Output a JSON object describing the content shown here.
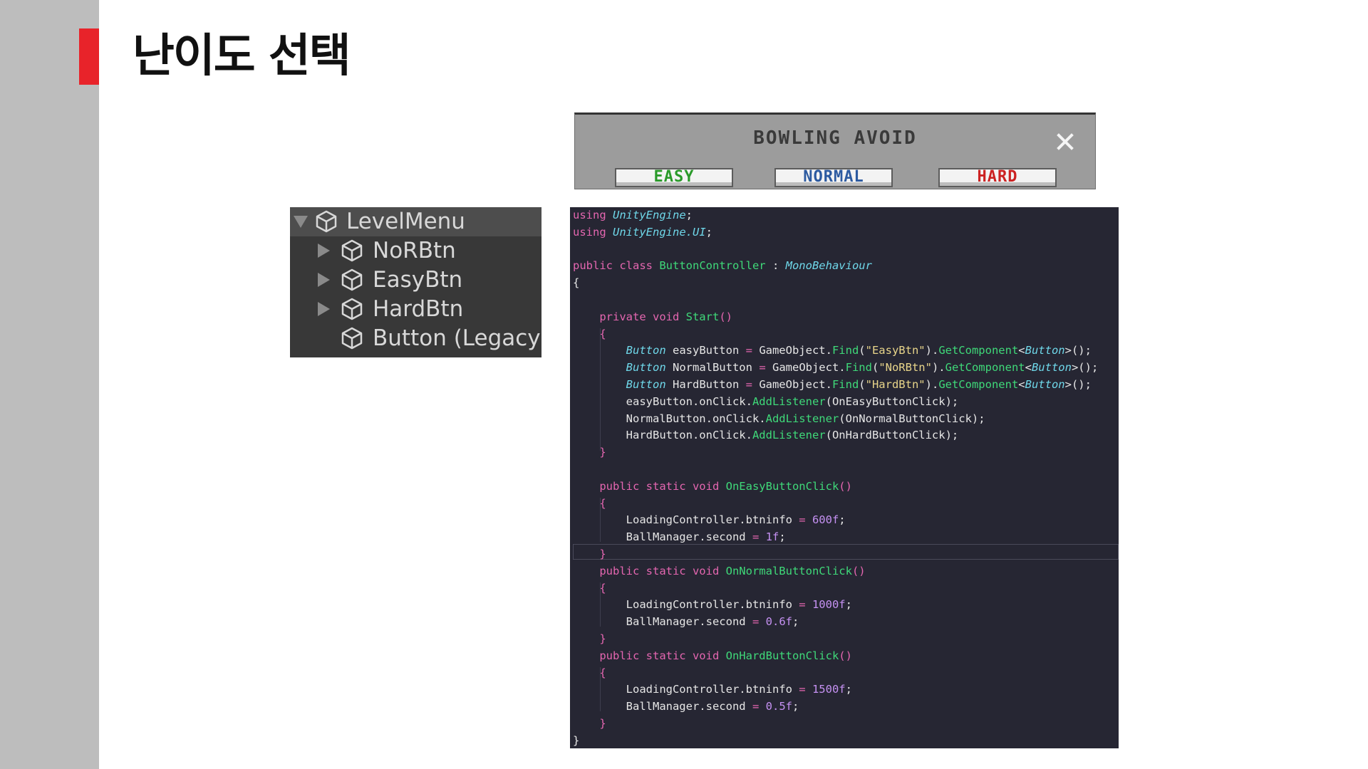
{
  "slide": {
    "title": "난이도 선택",
    "accent_color": "#e8232a"
  },
  "game": {
    "title": "BOWLING AVOID",
    "close_icon": "close-icon",
    "buttons": [
      {
        "label": "EASY",
        "color": "#2a9a2a"
      },
      {
        "label": "NORMAL",
        "color": "#2c5aa0"
      },
      {
        "label": "HARD",
        "color": "#cc2222"
      }
    ]
  },
  "hierarchy": {
    "root": "LevelMenu",
    "children": [
      "NoRBtn",
      "EasyBtn",
      "HardBtn",
      "Button (Legacy)"
    ],
    "icon": "cube-icon"
  },
  "code": {
    "lines": [
      [
        {
          "t": "using ",
          "c": "kw"
        },
        {
          "t": "UnityEngine",
          "c": "ty"
        },
        {
          "t": ";",
          "c": "pl"
        }
      ],
      [
        {
          "t": "using ",
          "c": "kw"
        },
        {
          "t": "UnityEngine.UI",
          "c": "ty"
        },
        {
          "t": ";",
          "c": "pl"
        }
      ],
      [],
      [
        {
          "t": "public class ",
          "c": "kw"
        },
        {
          "t": "ButtonController",
          "c": "me"
        },
        {
          "t": " : ",
          "c": "pl"
        },
        {
          "t": "MonoBehaviour",
          "c": "ty"
        }
      ],
      [
        {
          "t": "{",
          "c": "pl"
        }
      ],
      [],
      [
        {
          "t": "    private void ",
          "c": "kw"
        },
        {
          "t": "Start",
          "c": "me"
        },
        {
          "t": "()",
          "c": "kw"
        }
      ],
      [
        {
          "t": "    {",
          "c": "kw"
        }
      ],
      [
        {
          "t": "        ",
          "c": "pl"
        },
        {
          "t": "Button",
          "c": "ty"
        },
        {
          "t": " easyButton ",
          "c": "pl"
        },
        {
          "t": "=",
          "c": "op"
        },
        {
          "t": " GameObject.",
          "c": "pl"
        },
        {
          "t": "Find",
          "c": "me"
        },
        {
          "t": "(",
          "c": "pl"
        },
        {
          "t": "\"EasyBtn\"",
          "c": "st"
        },
        {
          "t": ").",
          "c": "pl"
        },
        {
          "t": "GetComponent",
          "c": "me"
        },
        {
          "t": "<",
          "c": "pl"
        },
        {
          "t": "Button",
          "c": "ty"
        },
        {
          "t": ">();",
          "c": "pl"
        }
      ],
      [
        {
          "t": "        ",
          "c": "pl"
        },
        {
          "t": "Button",
          "c": "ty"
        },
        {
          "t": " NormalButton ",
          "c": "pl"
        },
        {
          "t": "=",
          "c": "op"
        },
        {
          "t": " GameObject.",
          "c": "pl"
        },
        {
          "t": "Find",
          "c": "me"
        },
        {
          "t": "(",
          "c": "pl"
        },
        {
          "t": "\"NoRBtn\"",
          "c": "st"
        },
        {
          "t": ").",
          "c": "pl"
        },
        {
          "t": "GetComponent",
          "c": "me"
        },
        {
          "t": "<",
          "c": "pl"
        },
        {
          "t": "Button",
          "c": "ty"
        },
        {
          "t": ">();",
          "c": "pl"
        }
      ],
      [
        {
          "t": "        ",
          "c": "pl"
        },
        {
          "t": "Button",
          "c": "ty"
        },
        {
          "t": " HardButton ",
          "c": "pl"
        },
        {
          "t": "=",
          "c": "op"
        },
        {
          "t": " GameObject.",
          "c": "pl"
        },
        {
          "t": "Find",
          "c": "me"
        },
        {
          "t": "(",
          "c": "pl"
        },
        {
          "t": "\"HardBtn\"",
          "c": "st"
        },
        {
          "t": ").",
          "c": "pl"
        },
        {
          "t": "GetComponent",
          "c": "me"
        },
        {
          "t": "<",
          "c": "pl"
        },
        {
          "t": "Button",
          "c": "ty"
        },
        {
          "t": ">();",
          "c": "pl"
        }
      ],
      [
        {
          "t": "        easyButton.onClick.",
          "c": "pl"
        },
        {
          "t": "AddListener",
          "c": "me"
        },
        {
          "t": "(OnEasyButtonClick);",
          "c": "pl"
        }
      ],
      [
        {
          "t": "        NormalButton.onClick.",
          "c": "pl"
        },
        {
          "t": "AddListener",
          "c": "me"
        },
        {
          "t": "(OnNormalButtonClick);",
          "c": "pl"
        }
      ],
      [
        {
          "t": "        HardButton.onClick.",
          "c": "pl"
        },
        {
          "t": "AddListener",
          "c": "me"
        },
        {
          "t": "(OnHardButtonClick);",
          "c": "pl"
        }
      ],
      [
        {
          "t": "    }",
          "c": "kw"
        }
      ],
      [],
      [
        {
          "t": "    public static void ",
          "c": "kw"
        },
        {
          "t": "OnEasyButtonClick",
          "c": "me"
        },
        {
          "t": "()",
          "c": "kw"
        }
      ],
      [
        {
          "t": "    {",
          "c": "kw"
        }
      ],
      [
        {
          "t": "        LoadingController.btninfo ",
          "c": "pl"
        },
        {
          "t": "=",
          "c": "op"
        },
        {
          "t": " ",
          "c": "pl"
        },
        {
          "t": "600f",
          "c": "nu"
        },
        {
          "t": ";",
          "c": "pl"
        }
      ],
      [
        {
          "t": "        BallManager.second ",
          "c": "pl"
        },
        {
          "t": "=",
          "c": "op"
        },
        {
          "t": " ",
          "c": "pl"
        },
        {
          "t": "1f",
          "c": "nu"
        },
        {
          "t": ";",
          "c": "pl"
        }
      ],
      [
        {
          "t": "    }",
          "c": "kw"
        }
      ],
      [
        {
          "t": "    public static void ",
          "c": "kw"
        },
        {
          "t": "OnNormalButtonClick",
          "c": "me"
        },
        {
          "t": "()",
          "c": "kw"
        }
      ],
      [
        {
          "t": "    {",
          "c": "kw"
        }
      ],
      [
        {
          "t": "        LoadingController.btninfo ",
          "c": "pl"
        },
        {
          "t": "=",
          "c": "op"
        },
        {
          "t": " ",
          "c": "pl"
        },
        {
          "t": "1000f",
          "c": "nu"
        },
        {
          "t": ";",
          "c": "pl"
        }
      ],
      [
        {
          "t": "        BallManager.second ",
          "c": "pl"
        },
        {
          "t": "=",
          "c": "op"
        },
        {
          "t": " ",
          "c": "pl"
        },
        {
          "t": "0.6f",
          "c": "nu"
        },
        {
          "t": ";",
          "c": "pl"
        }
      ],
      [
        {
          "t": "    }",
          "c": "kw"
        }
      ],
      [
        {
          "t": "    public static void ",
          "c": "kw"
        },
        {
          "t": "OnHardButtonClick",
          "c": "me"
        },
        {
          "t": "()",
          "c": "kw"
        }
      ],
      [
        {
          "t": "    {",
          "c": "kw"
        }
      ],
      [
        {
          "t": "        LoadingController.btninfo ",
          "c": "pl"
        },
        {
          "t": "=",
          "c": "op"
        },
        {
          "t": " ",
          "c": "pl"
        },
        {
          "t": "1500f",
          "c": "nu"
        },
        {
          "t": ";",
          "c": "pl"
        }
      ],
      [
        {
          "t": "        BallManager.second ",
          "c": "pl"
        },
        {
          "t": "=",
          "c": "op"
        },
        {
          "t": " ",
          "c": "pl"
        },
        {
          "t": "0.5f",
          "c": "nu"
        },
        {
          "t": ";",
          "c": "pl"
        }
      ],
      [
        {
          "t": "    }",
          "c": "kw"
        }
      ],
      [
        {
          "t": "}",
          "c": "pl"
        }
      ]
    ]
  }
}
